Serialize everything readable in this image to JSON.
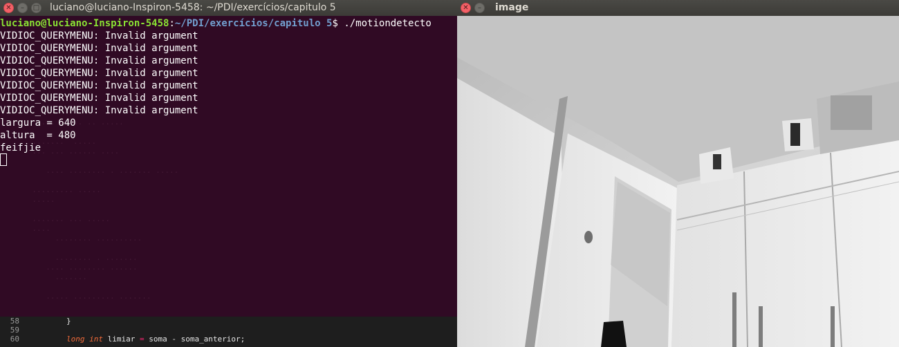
{
  "terminal": {
    "title": "luciano@luciano-Inspiron-5458: ~/PDI/exercícios/capitulo 5",
    "prompt": {
      "user_host": "luciano@luciano-Inspiron-5458",
      "separator": ":",
      "path": "~/PDI/exercícios/capitulo 5",
      "symbol": "$",
      "command": " ./motiondetecto"
    },
    "output_lines": [
      "VIDIOC_QUERYMENU: Invalid argument",
      "VIDIOC_QUERYMENU: Invalid argument",
      "VIDIOC_QUERYMENU: Invalid argument",
      "VIDIOC_QUERYMENU: Invalid argument",
      "VIDIOC_QUERYMENU: Invalid argument",
      "VIDIOC_QUERYMENU: Invalid argument",
      "VIDIOC_QUERYMENU: Invalid argument",
      "largura = 640",
      "altura  = 480",
      "feifjie"
    ]
  },
  "editor": {
    "lines": [
      {
        "num": "58",
        "code": "}"
      },
      {
        "num": "59",
        "code": ""
      },
      {
        "num": "60",
        "kw": "long int",
        "code": " limiar ",
        "op": "=",
        "rest": " soma - soma_anterior;"
      }
    ]
  },
  "image_window": {
    "title": "image"
  },
  "colors": {
    "terminal_bg": "#300a24",
    "prompt_user": "#8ae234",
    "prompt_path": "#729fcf",
    "close_button": "#f46067"
  }
}
